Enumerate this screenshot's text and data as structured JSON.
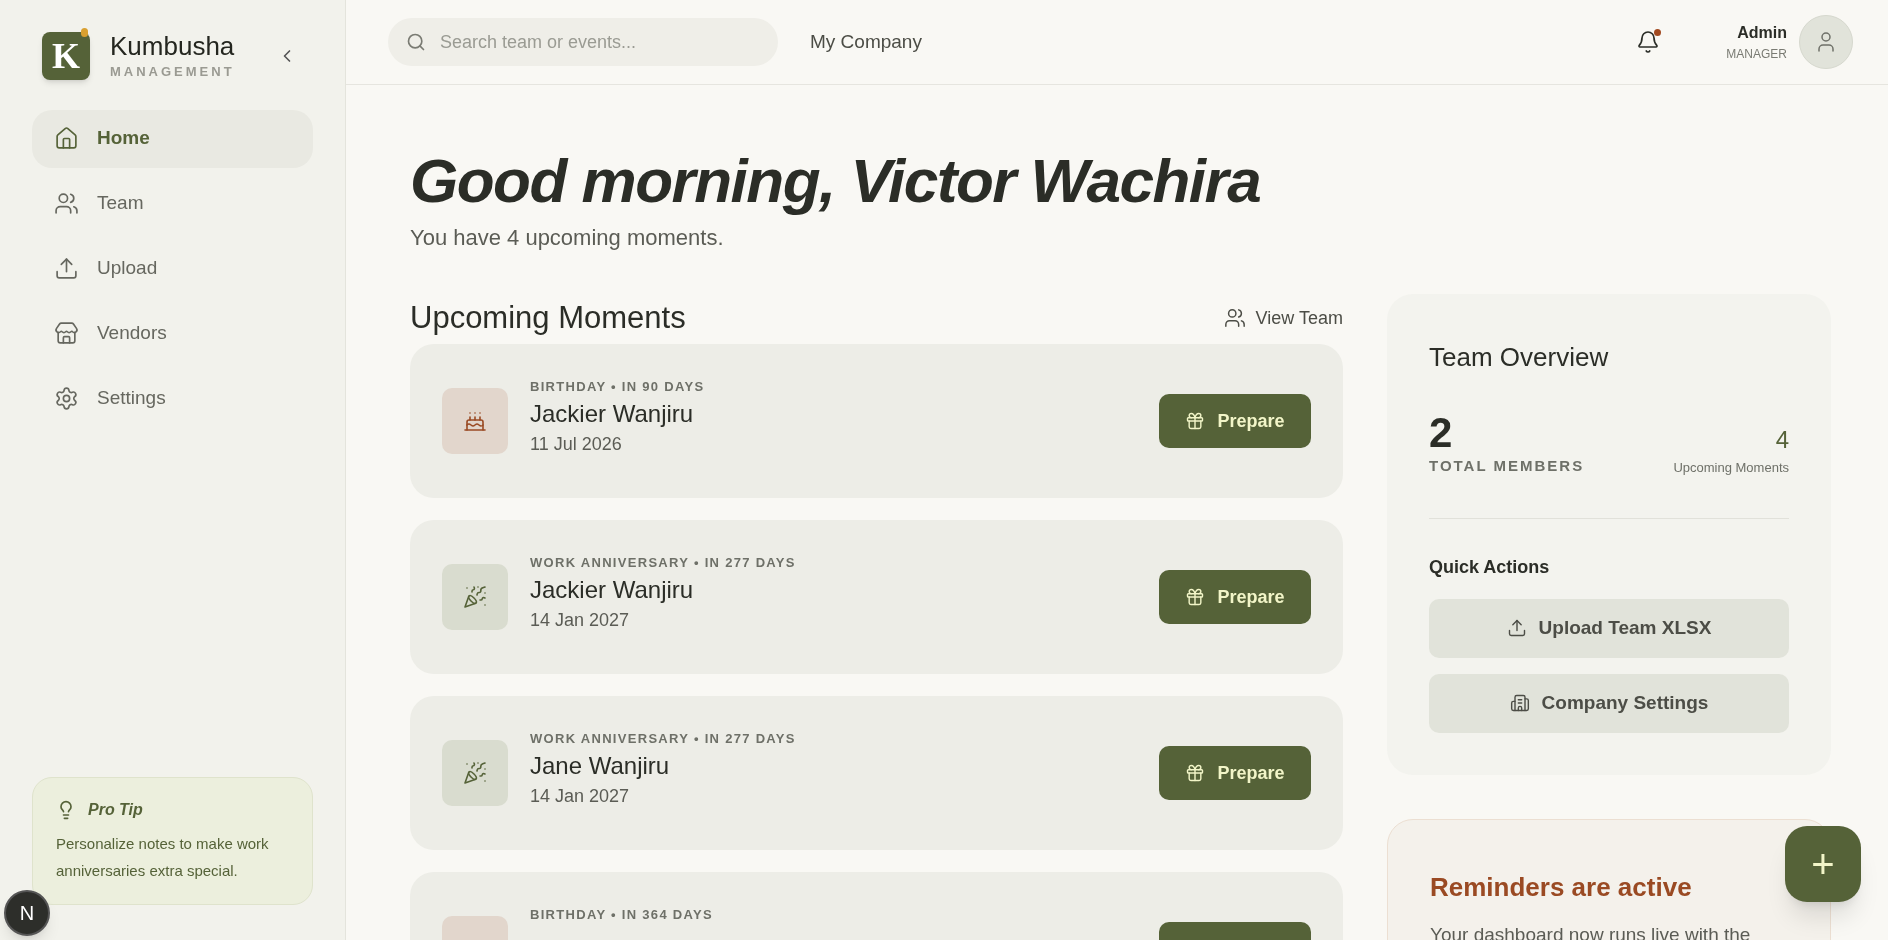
{
  "brand": {
    "logo_letter": "K",
    "name": "Kumbusha",
    "tagline": "MANAGEMENT"
  },
  "nav": [
    {
      "label": "Home",
      "selected": true
    },
    {
      "label": "Team",
      "selected": false
    },
    {
      "label": "Upload",
      "selected": false
    },
    {
      "label": "Vendors",
      "selected": false
    },
    {
      "label": "Settings",
      "selected": false
    }
  ],
  "pro_tip": {
    "title": "Pro Tip",
    "text": "Personalize notes to make work anniversaries extra special."
  },
  "dev_badge": {
    "label": "N"
  },
  "header": {
    "search": {
      "placeholder": "Search team or events..."
    },
    "company": "My Company",
    "notifications_unread": true,
    "user": {
      "name": "Admin",
      "role": "MANAGER"
    }
  },
  "greeting": {
    "title": "Good morning, Victor Wachira",
    "subtitle": "You have 4 upcoming moments."
  },
  "moments": {
    "title": "Upcoming Moments",
    "link": "View Team",
    "items": [
      {
        "kind": "birthday",
        "label": "BIRTHDAY • IN 90 DAYS",
        "name": "Jackier Wanjiru",
        "date": "11 Jul 2026",
        "action": "Prepare"
      },
      {
        "kind": "anniversary",
        "label": "WORK ANNIVERSARY • IN 277 DAYS",
        "name": "Jackier Wanjiru",
        "date": "14 Jan 2027",
        "action": "Prepare"
      },
      {
        "kind": "anniversary",
        "label": "WORK ANNIVERSARY • IN 277 DAYS",
        "name": "Jane Wanjiru",
        "date": "14 Jan 2027",
        "action": "Prepare"
      },
      {
        "kind": "birthday",
        "label": "BIRTHDAY • IN 364 DAYS"
      }
    ]
  },
  "overview": {
    "title": "Team Overview",
    "total": "2",
    "total_label": "TOTAL MEMBERS",
    "upcoming": "4",
    "upcoming_label": "Upcoming Moments",
    "quick_actions_title": "Quick Actions",
    "actions": [
      {
        "label": "Upload Team XLSX"
      },
      {
        "label": "Company Settings"
      }
    ]
  },
  "reminders": {
    "title": "Reminders are active",
    "text": "Your dashboard now runs live with the"
  },
  "fab": {
    "label": "+"
  }
}
